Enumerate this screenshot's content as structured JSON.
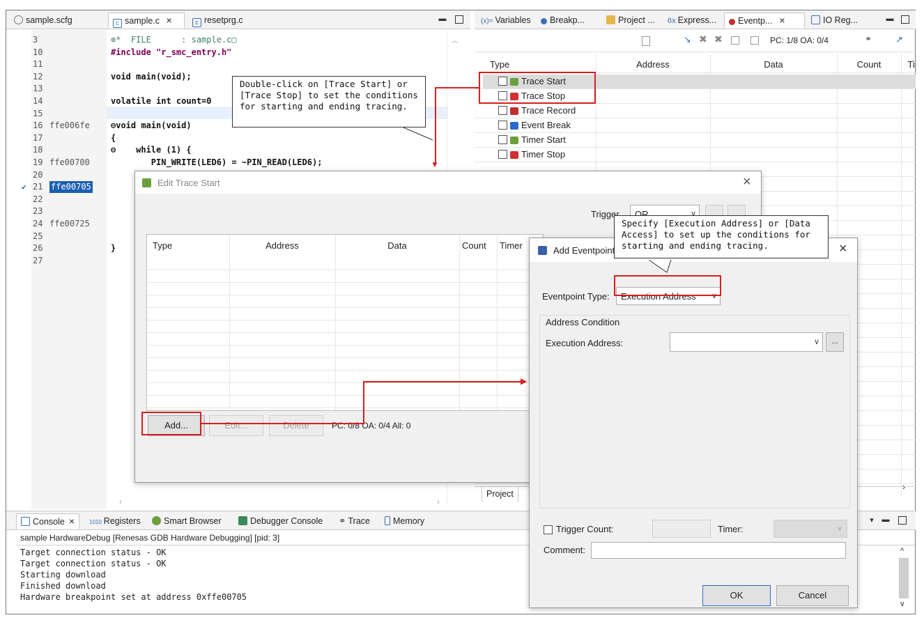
{
  "editor_tabs": [
    {
      "label": "sample.scfg"
    },
    {
      "label": "sample.c",
      "close": "×"
    },
    {
      "label": "resetprg.c"
    }
  ],
  "code_lines": [
    {
      "num": "3",
      "addr": "",
      "text": "⊕*  FILE      : sample.c▢"
    },
    {
      "num": "10",
      "addr": "",
      "text": "#include \"r_smc_entry.h\""
    },
    {
      "num": "11",
      "addr": "",
      "text": ""
    },
    {
      "num": "12",
      "addr": "",
      "text": "void main(void);"
    },
    {
      "num": "13",
      "addr": "",
      "text": ""
    },
    {
      "num": "14",
      "addr": "",
      "text": "volatile int count=0"
    },
    {
      "num": "15",
      "addr": "",
      "text": ""
    },
    {
      "num": "16",
      "addr": "ffe006fe",
      "text": "⊖void main(void)"
    },
    {
      "num": "17",
      "addr": "",
      "text": "{"
    },
    {
      "num": "18",
      "addr": "",
      "text": "⊖    while (1) {"
    },
    {
      "num": "19",
      "addr": "ffe00700",
      "text": "        PIN_WRITE(LED6) = ~PIN_READ(LED6);"
    },
    {
      "num": "20",
      "addr": "",
      "text": ""
    },
    {
      "num": "21",
      "addr": "ffe00705",
      "text": ""
    },
    {
      "num": "22",
      "addr": "",
      "text": ""
    },
    {
      "num": "23",
      "addr": "",
      "text": ""
    },
    {
      "num": "24",
      "addr": "ffe00725",
      "text": ""
    },
    {
      "num": "25",
      "addr": "",
      "text": ""
    },
    {
      "num": "26",
      "addr": "",
      "text": "}"
    },
    {
      "num": "27",
      "addr": "",
      "text": ""
    }
  ],
  "right_tabs": [
    {
      "label": "Variables"
    },
    {
      "label": "Breakp..."
    },
    {
      "label": "Project ..."
    },
    {
      "label": "Express..."
    },
    {
      "label": "Eventp...",
      "close": "×"
    },
    {
      "label": "IO Reg..."
    }
  ],
  "right_toolbar": {
    "status": "PC: 1/8 OA: 0/4"
  },
  "eventpoint_columns": [
    "Type",
    "Address",
    "Data",
    "Count",
    "Tim"
  ],
  "eventpoint_rows": [
    {
      "label": "Trace Start",
      "icon_color": "#6aa03c"
    },
    {
      "label": "Trace Stop",
      "icon_color": "#d03030"
    },
    {
      "label": "Trace Record",
      "icon_color": "#c03030"
    },
    {
      "label": "Event Break",
      "icon_color": "#2a6ad0"
    },
    {
      "label": "Timer Start",
      "icon_color": "#6aa03c"
    },
    {
      "label": "Timer Stop",
      "icon_color": "#d03030"
    }
  ],
  "right_bottom_tab": "Project",
  "callout1": {
    "text": "Double-click on [Trace Start] or [Trace Stop] to set the conditions for starting and ending tracing."
  },
  "callout2": {
    "text": "Specify [Execution Address] or [Data Access] to set up the conditions for starting and ending tracing."
  },
  "edit_dialog": {
    "title": "Edit Trace Start",
    "close": "×",
    "trigger_label": "Trigger",
    "trigger_value": "OR",
    "columns": [
      "Type",
      "Address",
      "Data",
      "Count",
      "Timer"
    ],
    "add": "Add...",
    "edit": "Edit...",
    "delete": "Delete",
    "status": "PC: 0/8 OA: 0/4 All: 0"
  },
  "add_dialog": {
    "title": "Add Eventpoint",
    "close": "×",
    "type_label": "Eventpoint Type:",
    "type_value": "Execution Address",
    "group_title": "Address Condition",
    "exec_label": "Execution Address:",
    "exec_value": "",
    "browse": "...",
    "trigger_count_label": "Trigger Count:",
    "timer_label": "Timer:",
    "comment_label": "Comment:",
    "comment_value": "",
    "ok": "OK",
    "cancel": "Cancel"
  },
  "console_tabs": [
    {
      "label": "Console",
      "close": "×"
    },
    {
      "label": "Registers"
    },
    {
      "label": "Smart Browser"
    },
    {
      "label": "Debugger Console"
    },
    {
      "label": "Trace"
    },
    {
      "label": "Memory"
    }
  ],
  "console": {
    "header": "sample HardwareDebug [Renesas GDB Hardware Debugging]  [pid: 3]",
    "lines": [
      "Target connection status - OK",
      "Target connection status - OK",
      "Starting download",
      "Finished download",
      "Hardware breakpoint set at address 0xffe00705"
    ]
  },
  "colors": {
    "red": "#d81e1e",
    "highlight": "#1c5fb0",
    "keyword": "#7f0055"
  }
}
